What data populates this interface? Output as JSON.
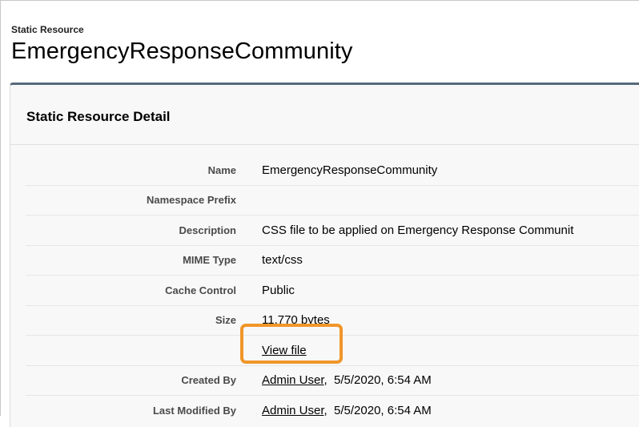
{
  "header": {
    "entity_type": "Static Resource",
    "title": "EmergencyResponseCommunity"
  },
  "panel": {
    "title": "Static Resource Detail"
  },
  "fields": {
    "name": {
      "label": "Name",
      "value": "EmergencyResponseCommunity"
    },
    "namespace_prefix": {
      "label": "Namespace Prefix",
      "value": ""
    },
    "description": {
      "label": "Description",
      "value": "CSS file to be applied on Emergency Response Communit"
    },
    "mime_type": {
      "label": "MIME Type",
      "value": "text/css"
    },
    "cache_control": {
      "label": "Cache Control",
      "value": "Public"
    },
    "size": {
      "label": "Size",
      "value": "11,770 bytes"
    },
    "view_file": {
      "label": "",
      "link": "View file"
    },
    "created_by": {
      "label": "Created By",
      "user": "Admin User",
      "date": ",  5/5/2020, 6:54 AM"
    },
    "last_modified_by": {
      "label": "Last Modified By",
      "user": "Admin User",
      "date": ",  5/5/2020, 6:54 AM"
    }
  },
  "colors": {
    "panel_top_border": "#56687a",
    "highlight": "#f0962a",
    "panel_bg": "#f8f8f8"
  }
}
